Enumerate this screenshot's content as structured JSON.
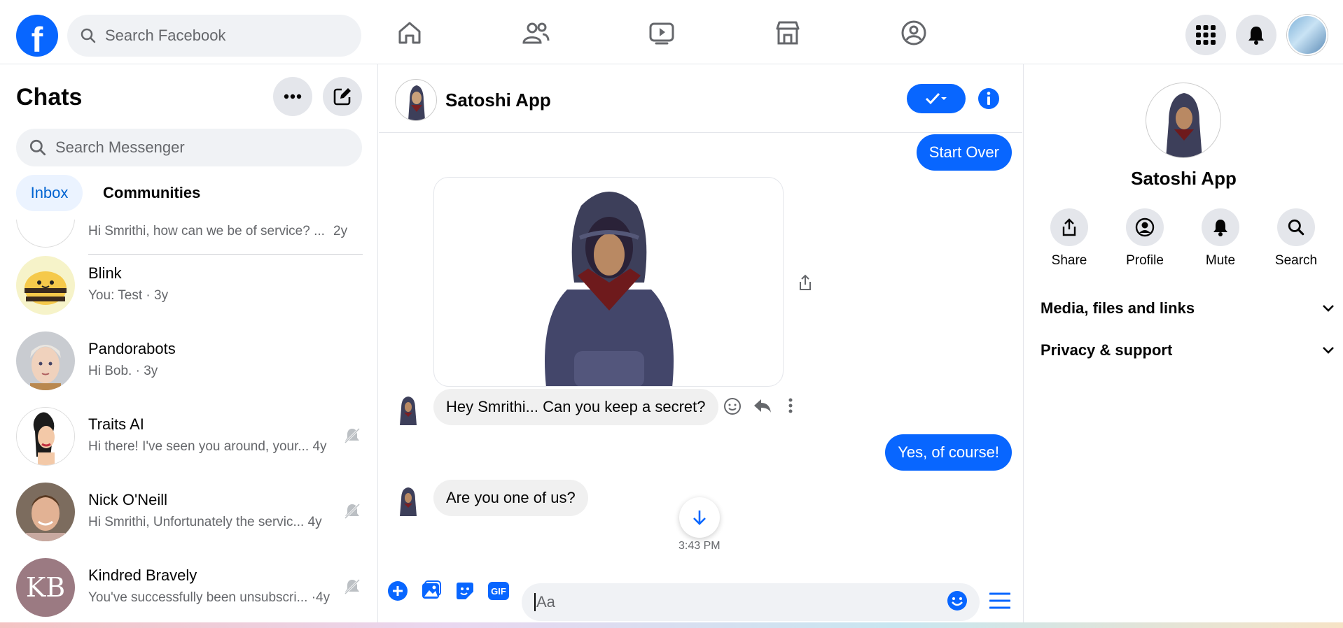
{
  "topbar": {
    "logo": "f",
    "search_placeholder": "Search Facebook",
    "nav_icons": [
      "home-icon",
      "friends-icon",
      "watch-icon",
      "marketplace-icon",
      "groups-icon"
    ],
    "right_icons": [
      "menu-grid-icon",
      "notifications-icon",
      "profile-avatar"
    ]
  },
  "sidebar": {
    "title": "Chats",
    "search_placeholder": "Search Messenger",
    "tabs": {
      "inbox": "Inbox",
      "communities": "Communities"
    },
    "partial_preview": "Hi Smrithi, how can we be of service? ...",
    "partial_time": "2y",
    "chats": [
      {
        "name": "Blink",
        "preview": "You: Test",
        "time": "3y",
        "muted": false
      },
      {
        "name": "Pandorabots",
        "preview": "Hi Bob.",
        "time": "3y",
        "muted": false
      },
      {
        "name": "Traits AI",
        "preview": "Hi there! I've seen you around, your...",
        "time": "4y",
        "muted": true
      },
      {
        "name": "Nick O'Neill",
        "preview": "Hi Smrithi, Unfortunately the servic...",
        "time": "4y",
        "muted": true
      },
      {
        "name": "Kindred Bravely",
        "preview": "You've successfully been unsubscri...",
        "time": "4y",
        "muted": true,
        "initials": "KB"
      }
    ]
  },
  "conversation": {
    "name": "Satoshi App",
    "messages": {
      "start_over": "Start Over",
      "secret": "Hey Smrithi... Can you keep a secret?",
      "yes": "Yes, of course!",
      "one_of_us": "Are you one of us?"
    },
    "timestamp": "3:43 PM",
    "composer_placeholder": "Aa",
    "gif_label": "GIF"
  },
  "details": {
    "name": "Satoshi App",
    "actions": [
      "Share",
      "Profile",
      "Mute",
      "Search"
    ],
    "sections": [
      "Media, files and links",
      "Privacy & support"
    ]
  },
  "colors": {
    "accent": "#0866ff",
    "panel_gray": "#f0f2f5"
  }
}
